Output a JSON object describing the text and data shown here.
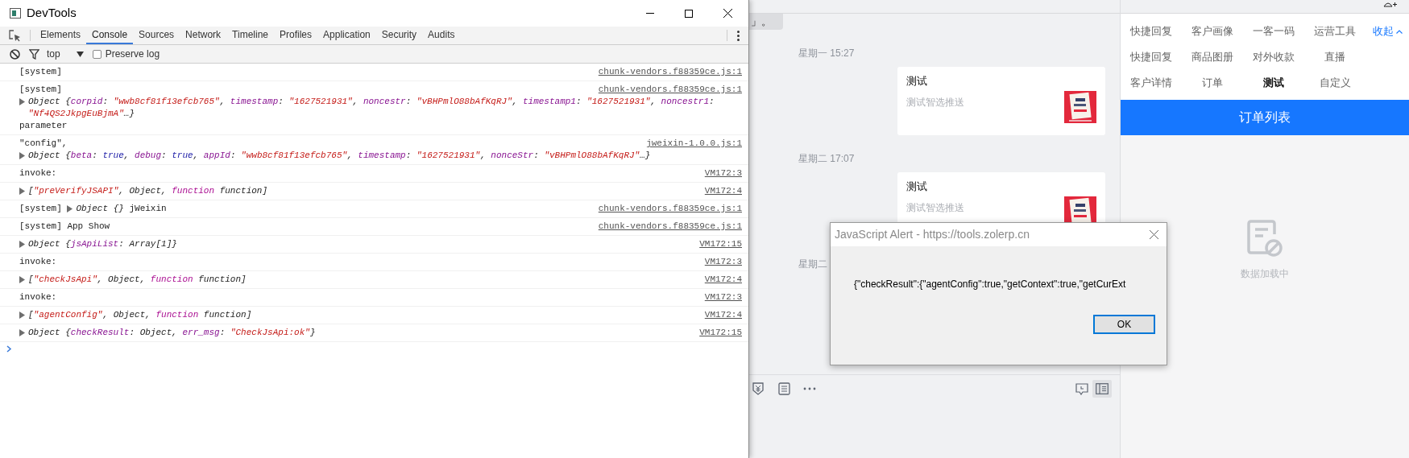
{
  "devtools": {
    "title": "DevTools",
    "tabs": [
      {
        "label": "Elements",
        "selected": false
      },
      {
        "label": "Console",
        "selected": true
      },
      {
        "label": "Sources",
        "selected": false
      },
      {
        "label": "Network",
        "selected": false
      },
      {
        "label": "Timeline",
        "selected": false
      },
      {
        "label": "Profiles",
        "selected": false
      },
      {
        "label": "Application",
        "selected": false
      },
      {
        "label": "Security",
        "selected": false
      },
      {
        "label": "Audits",
        "selected": false
      }
    ],
    "filter": {
      "context": "top",
      "preserve_log": {
        "label": "Preserve log",
        "checked": false
      }
    },
    "console": [
      {
        "source": "chunk-vendors.f88359ce.js:1",
        "lines": [
          [
            {
              "kind": "plain",
              "text": "[system]"
            }
          ]
        ]
      },
      {
        "source": "chunk-vendors.f88359ce.js:1",
        "lines": [
          [
            {
              "kind": "plain",
              "text": "[system]"
            }
          ],
          [
            {
              "kind": "toggle"
            },
            {
              "kind": "italic",
              "text": "Object {"
            },
            {
              "kind": "key",
              "text": "corpid"
            },
            {
              "kind": "italic",
              "text": ": "
            },
            {
              "kind": "string",
              "text": "\"wwb8cf81f13efcb765\""
            },
            {
              "kind": "italic",
              "text": ", "
            },
            {
              "kind": "key",
              "text": "timestamp"
            },
            {
              "kind": "italic",
              "text": ": "
            },
            {
              "kind": "string",
              "text": "\"1627521931\""
            },
            {
              "kind": "italic",
              "text": ", "
            },
            {
              "kind": "key",
              "text": "noncestr"
            },
            {
              "kind": "italic",
              "text": ": "
            },
            {
              "kind": "string",
              "text": "\"vBHPmlO88bAfKqRJ\""
            },
            {
              "kind": "italic",
              "text": ", "
            },
            {
              "kind": "key",
              "text": "timestamp1"
            },
            {
              "kind": "italic",
              "text": ": "
            },
            {
              "kind": "string",
              "text": "\"1627521931\""
            },
            {
              "kind": "italic",
              "text": ", "
            },
            {
              "kind": "key",
              "text": "noncestr1"
            },
            {
              "kind": "italic",
              "text": ":"
            }
          ],
          [
            {
              "kind": "indent"
            },
            {
              "kind": "string",
              "text": "\"Nf4QS2JkpgEuBjmA\""
            },
            {
              "kind": "italic",
              "text": "…}"
            }
          ],
          [
            {
              "kind": "plain",
              "text": "parameter"
            }
          ]
        ]
      },
      {
        "source": "jweixin-1.0.0.js:1",
        "lines": [
          [
            {
              "kind": "plain",
              "text": "\"config\","
            }
          ],
          [
            {
              "kind": "toggle"
            },
            {
              "kind": "italic",
              "text": "Object {"
            },
            {
              "kind": "key",
              "text": "beta"
            },
            {
              "kind": "italic",
              "text": ": "
            },
            {
              "kind": "bool",
              "text": "true"
            },
            {
              "kind": "italic",
              "text": ", "
            },
            {
              "kind": "key",
              "text": "debug"
            },
            {
              "kind": "italic",
              "text": ": "
            },
            {
              "kind": "bool",
              "text": "true"
            },
            {
              "kind": "italic",
              "text": ", "
            },
            {
              "kind": "key",
              "text": "appId"
            },
            {
              "kind": "italic",
              "text": ": "
            },
            {
              "kind": "string",
              "text": "\"wwb8cf81f13efcb765\""
            },
            {
              "kind": "italic",
              "text": ", "
            },
            {
              "kind": "key",
              "text": "timestamp"
            },
            {
              "kind": "italic",
              "text": ": "
            },
            {
              "kind": "string",
              "text": "\"1627521931\""
            },
            {
              "kind": "italic",
              "text": ", "
            },
            {
              "kind": "key",
              "text": "nonceStr"
            },
            {
              "kind": "italic",
              "text": ": "
            },
            {
              "kind": "string",
              "text": "\"vBHPmlO88bAfKqRJ\""
            },
            {
              "kind": "italic",
              "text": "…}"
            }
          ]
        ]
      },
      {
        "source": "VM172:3",
        "lines": [
          [
            {
              "kind": "plain",
              "text": "invoke:"
            }
          ]
        ]
      },
      {
        "source": "VM172:4",
        "lines": [
          [
            {
              "kind": "toggle"
            },
            {
              "kind": "italic",
              "text": "["
            },
            {
              "kind": "string",
              "text": "\"preVerifyJSAPI\""
            },
            {
              "kind": "italic",
              "text": ", Object, "
            },
            {
              "kind": "fn",
              "text": "function"
            },
            {
              "kind": "italic",
              "text": " function]"
            }
          ]
        ]
      },
      {
        "source": "chunk-vendors.f88359ce.js:1",
        "lines": [
          [
            {
              "kind": "plain",
              "text": "[system] "
            },
            {
              "kind": "toggle"
            },
            {
              "kind": "italic",
              "text": "Object {}"
            },
            {
              "kind": "plain",
              "text": " jWeixin"
            }
          ]
        ]
      },
      {
        "source": "chunk-vendors.f88359ce.js:1",
        "lines": [
          [
            {
              "kind": "plain",
              "text": "[system] App Show"
            }
          ]
        ]
      },
      {
        "source": "VM172:15",
        "lines": [
          [
            {
              "kind": "toggle"
            },
            {
              "kind": "italic",
              "text": "Object {"
            },
            {
              "kind": "key",
              "text": "jsApiList"
            },
            {
              "kind": "italic",
              "text": ": Array[1]}"
            }
          ]
        ]
      },
      {
        "source": "VM172:3",
        "lines": [
          [
            {
              "kind": "plain",
              "text": "invoke:"
            }
          ]
        ]
      },
      {
        "source": "VM172:4",
        "lines": [
          [
            {
              "kind": "toggle"
            },
            {
              "kind": "italic",
              "text": "["
            },
            {
              "kind": "string",
              "text": "\"checkJsApi\""
            },
            {
              "kind": "italic",
              "text": ", Object, "
            },
            {
              "kind": "fn",
              "text": "function"
            },
            {
              "kind": "italic",
              "text": " function]"
            }
          ]
        ]
      },
      {
        "source": "VM172:3",
        "lines": [
          [
            {
              "kind": "plain",
              "text": "invoke:"
            }
          ]
        ]
      },
      {
        "source": "VM172:4",
        "lines": [
          [
            {
              "kind": "toggle"
            },
            {
              "kind": "italic",
              "text": "["
            },
            {
              "kind": "string",
              "text": "\"agentConfig\""
            },
            {
              "kind": "italic",
              "text": ", Object, "
            },
            {
              "kind": "fn",
              "text": "function"
            },
            {
              "kind": "italic",
              "text": " function]"
            }
          ]
        ]
      },
      {
        "source": "VM172:15",
        "lines": [
          [
            {
              "kind": "toggle"
            },
            {
              "kind": "italic",
              "text": "Object {"
            },
            {
              "kind": "key",
              "text": "checkResult"
            },
            {
              "kind": "italic",
              "text": ": Object, "
            },
            {
              "kind": "key",
              "text": "err_msg"
            },
            {
              "kind": "italic",
              "text": ": "
            },
            {
              "kind": "string",
              "text": "\"CheckJsApi:ok\""
            },
            {
              "kind": "italic",
              "text": "}"
            }
          ]
        ]
      }
    ]
  },
  "chat": {
    "cut_message": "」。",
    "items": [
      {
        "kind": "time",
        "text": "星期一 15:27"
      },
      {
        "kind": "card",
        "title": "测试",
        "subtitle": "测试智选推送"
      },
      {
        "kind": "time",
        "text": "星期二 17:07"
      },
      {
        "kind": "card",
        "title": "测试",
        "subtitle": "测试智选推送"
      },
      {
        "kind": "time",
        "text": "星期二"
      }
    ]
  },
  "side_panel": {
    "tool_rows": [
      [
        {
          "label": "快捷回复",
          "selected": false
        },
        {
          "label": "客户画像",
          "selected": false
        },
        {
          "label": "一客一码",
          "selected": false
        },
        {
          "label": "运营工具",
          "selected": false
        }
      ],
      [
        {
          "label": "快捷回复",
          "selected": false
        },
        {
          "label": "商品图册",
          "selected": false
        },
        {
          "label": "对外收款",
          "selected": false
        },
        {
          "label": "直播",
          "selected": false
        }
      ],
      [
        {
          "label": "客户详情",
          "selected": false
        },
        {
          "label": "订单",
          "selected": false
        },
        {
          "label": "测试",
          "selected": true
        },
        {
          "label": "自定义",
          "selected": false
        }
      ]
    ],
    "collapse": "收起",
    "header": "订单列表",
    "empty_text": "数据加载中"
  },
  "alert": {
    "title": "JavaScript Alert - https://tools.zolerp.cn",
    "message": "{\"checkResult\":{\"agentConfig\":true,\"getContext\":true,\"getCurExt",
    "ok": "OK"
  }
}
